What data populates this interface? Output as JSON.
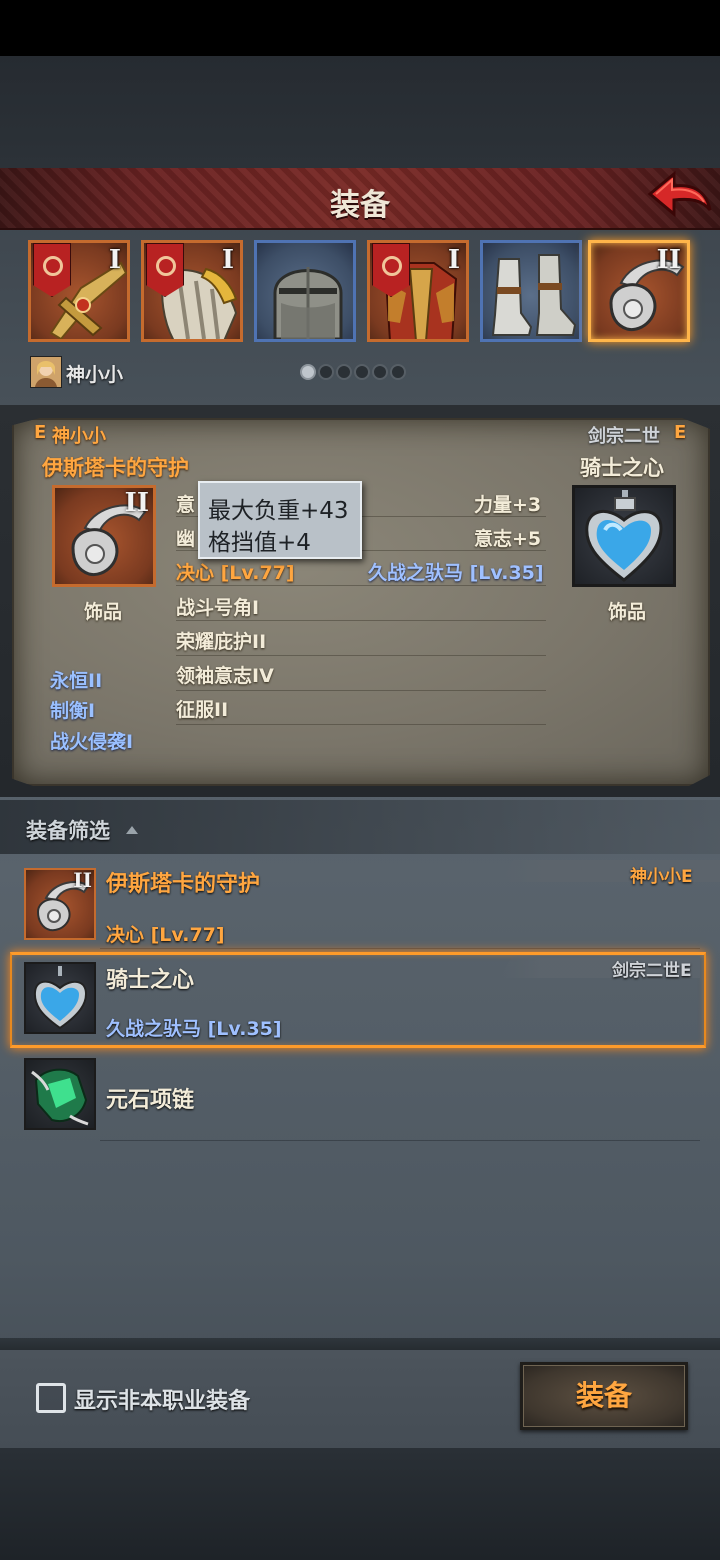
{
  "header": {
    "title": "装备"
  },
  "slots": [
    {
      "tier": "I",
      "kind": "banner-weapon"
    },
    {
      "tier": "I",
      "kind": "banner-shoulder"
    },
    {
      "tier": "",
      "kind": "helmet"
    },
    {
      "tier": "I",
      "kind": "banner-armor"
    },
    {
      "tier": "",
      "kind": "boots"
    },
    {
      "tier": "II",
      "kind": "necklace",
      "selected": true
    }
  ],
  "owner": {
    "name": "神小小"
  },
  "pager": {
    "pages": 6,
    "current": 1
  },
  "compare": {
    "left": {
      "grade": "E",
      "owner": "神小小",
      "name": "伊斯塔卡的守护",
      "tier": "II",
      "type": "饰品",
      "stats_partial": [
        "意",
        "幽"
      ],
      "skill_main": "决心 [Lv.77]",
      "skills": [
        "战斗号角I",
        "荣耀庇护II",
        "领袖意志IV",
        "征服II"
      ],
      "sig_traits": [
        "永恒II",
        "制衡I",
        "战火侵袭I"
      ]
    },
    "right": {
      "owner": "剑宗二世",
      "grade": "E",
      "name": "骑士之心",
      "type": "饰品",
      "stats": [
        "力量+3",
        "意志+5"
      ],
      "skill_main": "久战之驮马 [Lv.35]"
    },
    "tooltip": [
      "最大负重+43",
      "格挡值+4"
    ]
  },
  "filter": {
    "label": "装备筛选"
  },
  "list": [
    {
      "name": "伊斯塔卡的守护",
      "tier": "II",
      "skill": "决心 [Lv.77]",
      "owner": "神小小E",
      "selected": false
    },
    {
      "name": "骑士之心",
      "tier": "",
      "skill": "久战之驮马 [Lv.35]",
      "owner": "剑宗二世E",
      "selected": true
    },
    {
      "name": "元石项链",
      "tier": "",
      "skill": "",
      "owner": "",
      "selected": false
    }
  ],
  "footer": {
    "checkbox_label": "显示非本职业装备",
    "checked": false,
    "equip_button": "装备"
  },
  "colors": {
    "accent_orange": "#ffa640",
    "header_red": "#7a2a26",
    "trait_blue": "#9fc0ff",
    "select_glow": "#ff9b2a"
  },
  "icons": [
    "back-arrow-icon",
    "necklace-icon",
    "heart-pendant-icon",
    "green-crystal-icon",
    "helmet-icon",
    "boots-icon"
  ]
}
